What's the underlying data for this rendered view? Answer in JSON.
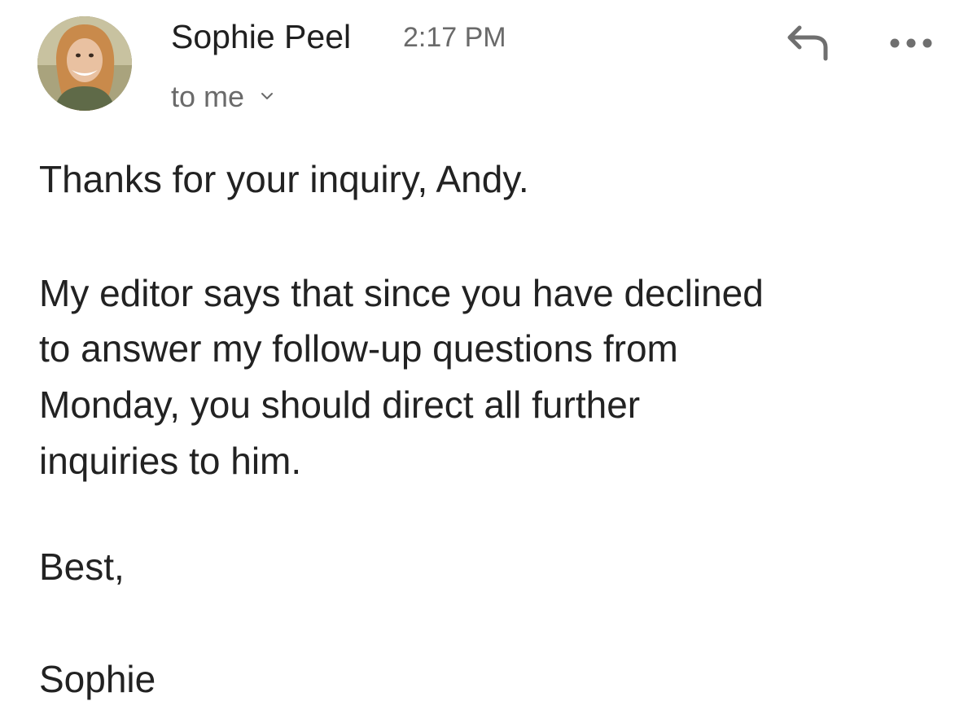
{
  "header": {
    "sender_name": "Sophie Peel",
    "time": "2:17 PM",
    "recipient": "to me",
    "icons": {
      "avatar": "sender-avatar-photo",
      "reply": "reply-arrow-icon",
      "more": "more-options-icon",
      "recipient_toggle": "chevron-down-icon"
    }
  },
  "message": {
    "greeting": "Thanks for your inquiry, Andy.",
    "paragraph_lines": [
      "My editor says that since you have declined",
      "to answer my follow-up questions from",
      "Monday, you should direct all further",
      "inquiries to him."
    ],
    "closing": "Best,",
    "signature": "Sophie"
  }
}
